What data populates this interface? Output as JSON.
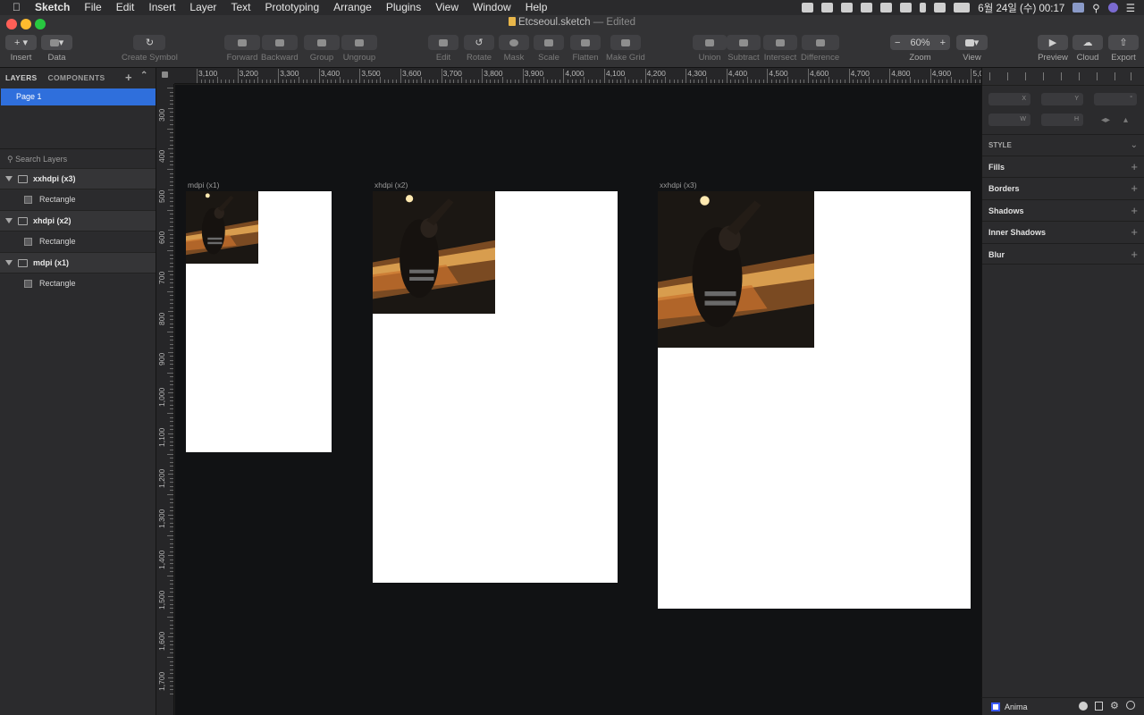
{
  "menubar": {
    "app": "Sketch",
    "items": [
      "File",
      "Edit",
      "Insert",
      "Layer",
      "Text",
      "Prototyping",
      "Arrange",
      "Plugins",
      "View",
      "Window",
      "Help"
    ],
    "clock": "6월 24일 (수) 00:17"
  },
  "window": {
    "title": "Etcseoul.sketch",
    "status": "— Edited"
  },
  "toolbar": {
    "insert": "Insert",
    "data": "Data",
    "create_symbol": "Create Symbol",
    "forward": "Forward",
    "backward": "Backward",
    "group": "Group",
    "ungroup": "Ungroup",
    "edit": "Edit",
    "rotate": "Rotate",
    "mask": "Mask",
    "scale": "Scale",
    "flatten": "Flatten",
    "make_grid": "Make Grid",
    "union": "Union",
    "subtract": "Subtract",
    "intersect": "Intersect",
    "difference": "Difference",
    "zoom_label": "Zoom",
    "zoom_value": "60%",
    "view": "View",
    "preview": "Preview",
    "cloud": "Cloud",
    "export": "Export"
  },
  "left_panel": {
    "tabs": [
      "LAYERS",
      "COMPONENTS"
    ],
    "page": "Page 1",
    "search_placeholder": "Search Layers",
    "layers": [
      {
        "name": "xxhdpi  (x3)",
        "child": "Rectangle"
      },
      {
        "name": "xhdpi (x2)",
        "child": "Rectangle"
      },
      {
        "name": "mdpi (x1)",
        "child": "Rectangle"
      }
    ]
  },
  "ruler": {
    "top": [
      "3,100",
      "3,200",
      "3,300",
      "3,400",
      "3,500",
      "3,600",
      "3,700",
      "3,800",
      "3,900",
      "4,000",
      "4,100",
      "4,200",
      "4,300",
      "4,400",
      "4,500",
      "4,600",
      "4,700",
      "4,800",
      "4,900",
      "5,0"
    ],
    "left": [
      "300",
      "400",
      "500",
      "600",
      "700",
      "800",
      "900",
      "1,000",
      "1,100",
      "1,200",
      "1,300",
      "1,400",
      "1,500",
      "1,600",
      "1,700"
    ]
  },
  "artboards": [
    {
      "name": "mdpi (x1)"
    },
    {
      "name": "xhdpi (x2)"
    },
    {
      "name": "xxhdpi  (x3)"
    }
  ],
  "right_panel": {
    "fields": [
      "X",
      "Y",
      "W",
      "H"
    ],
    "style_title": "STYLE",
    "sections": [
      "Fills",
      "Borders",
      "Shadows",
      "Inner Shadows",
      "Blur"
    ],
    "plugin": "Anima"
  },
  "colors": {
    "selection": "#2f6fdc",
    "canvas": "#111214",
    "panel": "#2b2b2d"
  }
}
